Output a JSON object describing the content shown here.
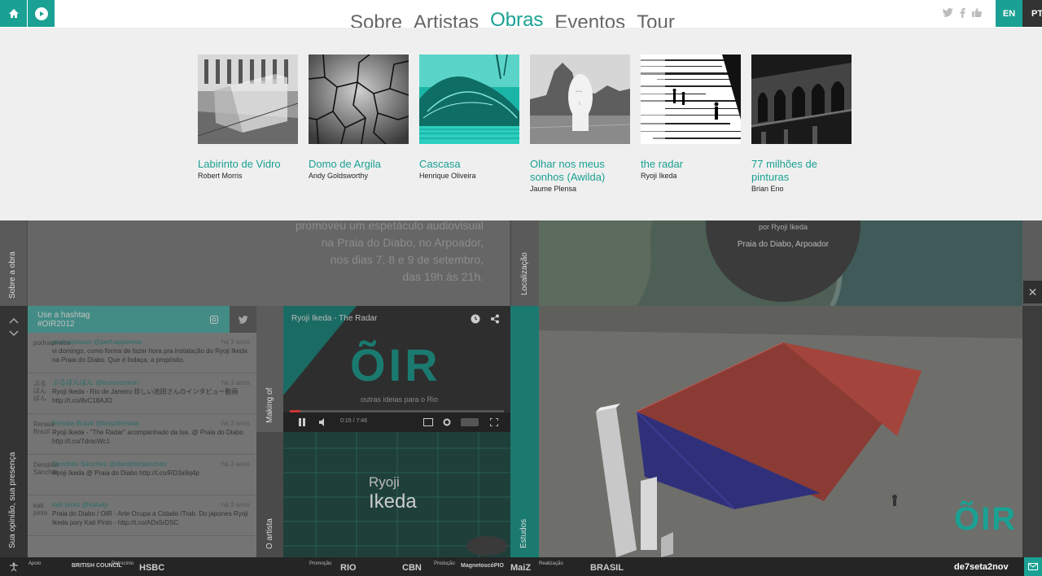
{
  "nav": {
    "items": [
      "Sobre",
      "Artistas",
      "Obras",
      "Eventos",
      "Tour"
    ],
    "active": "Obras"
  },
  "lang": {
    "en": "EN",
    "pt": "PT"
  },
  "works": [
    {
      "title": "Labirinto de Vidro",
      "artist": "Robert Morris"
    },
    {
      "title": "Domo de Argila",
      "artist": "Andy Goldsworthy"
    },
    {
      "title": "Cascasa",
      "artist": "Henrique Oliveira"
    },
    {
      "title": "Olhar nos meus sonhos (Awilda)",
      "artist": "Jaume Plensa"
    },
    {
      "title": "the radar",
      "artist": "Ryoji Ikeda"
    },
    {
      "title": "77 milhões de pinturas",
      "artist": "Brian Eno"
    }
  ],
  "sobre": {
    "label": "Sobre a obra",
    "text_lines": [
      "promoveu um espetáculo audiovisual",
      "na Praia do Diabo, no Arpoador,",
      "nos dias 7, 8 e 9 de setembro,",
      "das 19h às 21h."
    ]
  },
  "location": {
    "label": "Localização",
    "by": "por Ryoji Ikeda",
    "place": "Praia do Diabo, Arpoador"
  },
  "feed": {
    "heading": "Use a hashtag",
    "hashtag": "#OIR2012",
    "side_label": "Sua opinião, sua presença",
    "tweets": [
      {
        "avatar": "podnapiness",
        "user": "podnapiness @perhappiness",
        "time": "há 3 anos",
        "text": "vi domingo, como forma de fazer hora pra instalação do Ryoji Ikeda na Praia do Diabo. Que é fodaça, a propósito."
      },
      {
        "avatar": "ぶるぼんぼん",
        "user": "ぶるぼんぼん @buruvonvon",
        "time": "há 3 anos",
        "text": "Ryoji Ikeda - Rio de Janeiro 珍しい池田さんのインタビュー動画 http://t.co/8vC18AJO"
      },
      {
        "avatar": "Renata Brazil",
        "user": "Renata Brazil @brazilrenata",
        "time": "há 3 anos",
        "text": "Ryoji Ikeda - \"The Radar\" acompanhado da lua. @ Praia do Diabo http://t.co/7dracWc1"
      },
      {
        "avatar": "Dendrito Sánchez",
        "user": "Dendrito Sánchez @dendritosanchez",
        "time": "há 3 anos",
        "text": "Ryoji Ikeda @ Praia do Diabo http://t.co/RD3a9q4p"
      },
      {
        "avatar": "kati pinto",
        "user": "kati pinto @katwly",
        "time": "há 3 anos",
        "text": "Praia do Diabo / OIR - Arte Ocupa a Cidade /Trab. Do japones Ryoji Ikeda pory Kati Pinto - http://t.co/ADx5rDSC"
      }
    ]
  },
  "video": {
    "making_label": "Making of",
    "title": "Ryoji Ikeda - The Radar",
    "logo": "ÕIR",
    "tagline": "outras ideias para o Rio",
    "time": "0:15 / 7:46"
  },
  "artist": {
    "label": "O artista",
    "first": "Ryoji",
    "last": "Ikeda"
  },
  "estudos": {
    "label": "Estudos"
  },
  "sketch_logo": "ÕIR",
  "footer": {
    "apoio": "Apoio",
    "patrocinio": "Patrocínio",
    "promocao": "Promoção",
    "producao": "Produção",
    "realizacao": "Realização",
    "sponsors": [
      "BRITISH COUNCIL",
      "HSBC",
      "RIO",
      "CBN",
      "MagnetoscóPIO",
      "MaiZ",
      "BRASIL"
    ],
    "dates": "de7seta2nov"
  },
  "colors": {
    "accent": "#1aa193"
  }
}
